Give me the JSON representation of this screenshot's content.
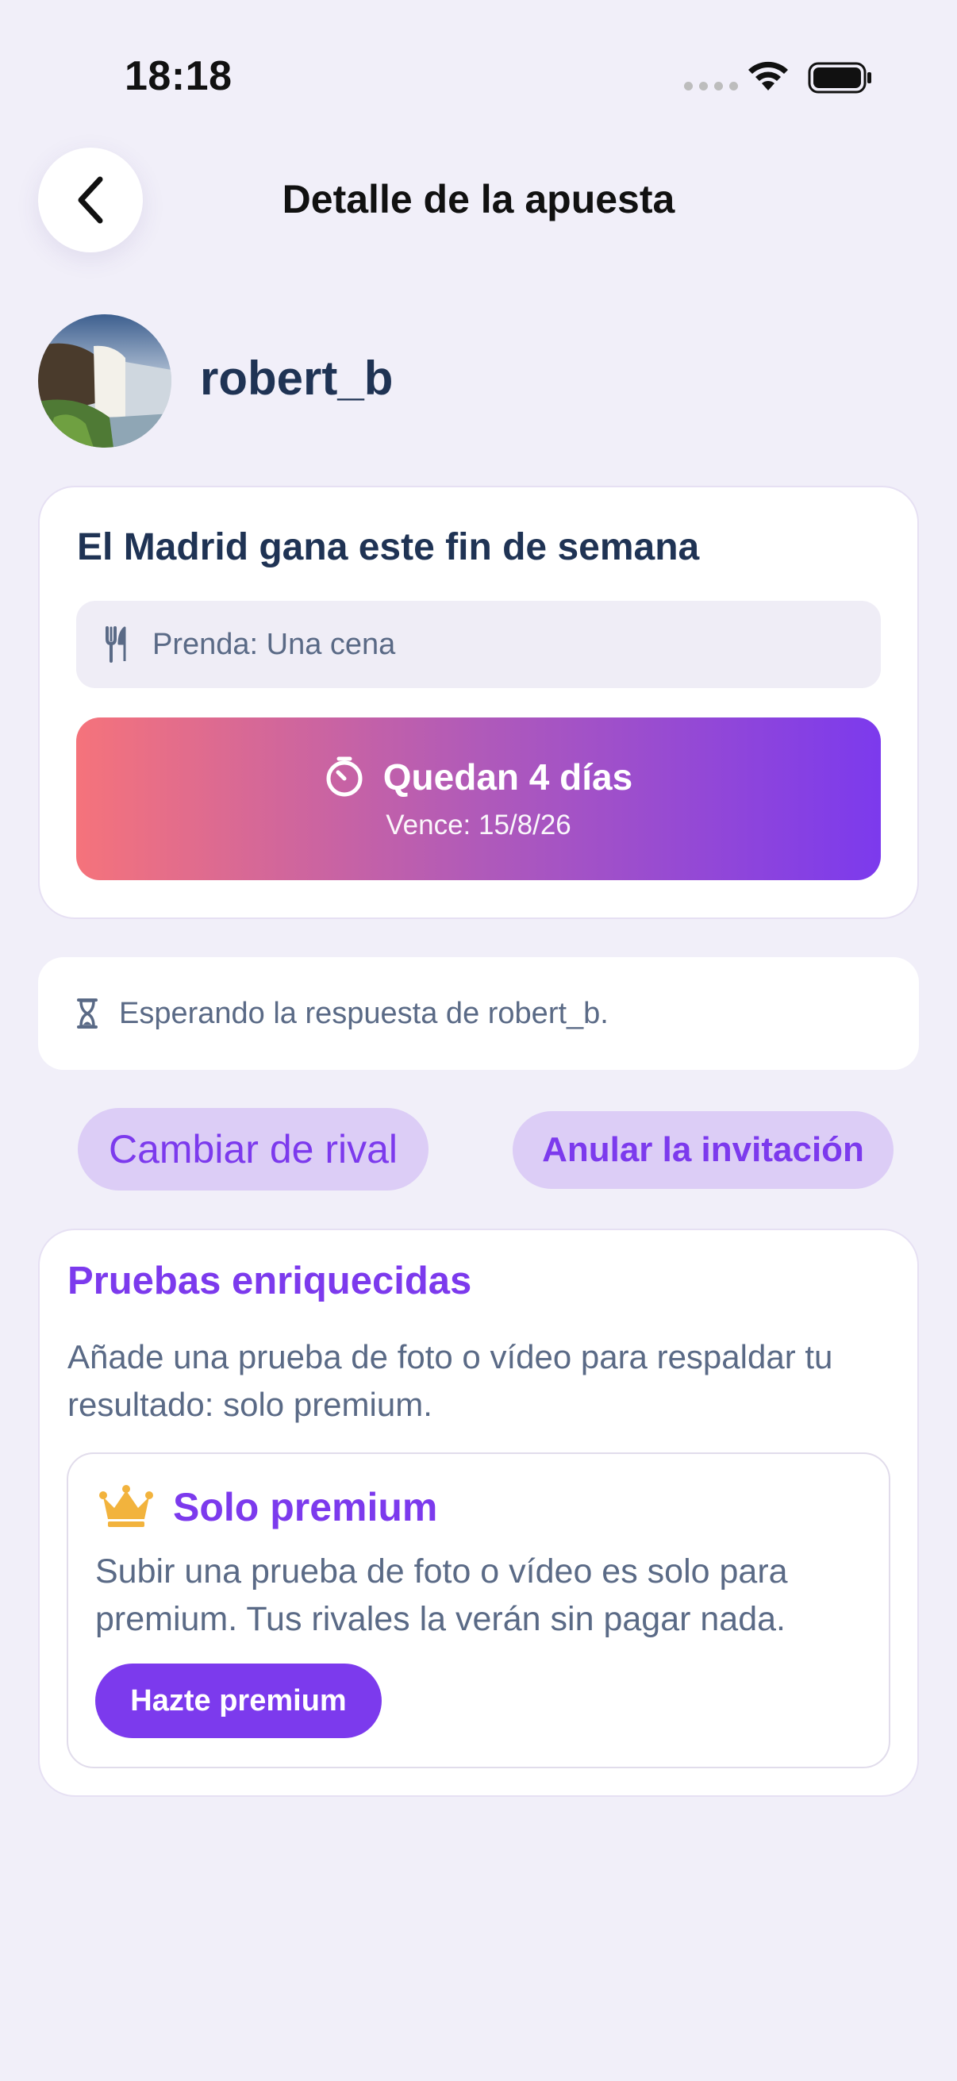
{
  "status_bar": {
    "time": "18:18",
    "icons": [
      "cellular-icon",
      "wifi-icon",
      "battery-icon"
    ]
  },
  "header": {
    "title": "Detalle de la apuesta",
    "back_icon": "chevron-left-icon"
  },
  "user": {
    "username": "robert_b",
    "avatar": "waterfall-landscape-photo"
  },
  "bet": {
    "title": "El Madrid gana este fin de semana",
    "stake": "Prenda: Una cena",
    "stake_icon": "fork-knife-icon",
    "countdown": {
      "label": "Quedan 4 días",
      "due": "Vence: 15/8/26",
      "icon": "timer-icon",
      "gradient": [
        "#f5737b",
        "#7c3aed"
      ]
    }
  },
  "waiting": {
    "text": "Esperando la respuesta de robert_b.",
    "icon": "hourglass-icon"
  },
  "actions": {
    "change_rival": "Cambiar de rival",
    "cancel_invitation": "Anular la invitación"
  },
  "evidence": {
    "title": "Pruebas enriquecidas",
    "description": "Añade una prueba de foto o vídeo para respaldar tu resultado: solo premium.",
    "premium": {
      "icon": "crown-icon",
      "title": "Solo premium",
      "description": "Subir una prueba de foto o vídeo es solo para premium. Tus rivales la verán sin pagar nada.",
      "button": "Hazte premium"
    }
  },
  "colors": {
    "accent": "#7c3aed",
    "accent_soft": "#dccdf6",
    "background": "#f1eff9",
    "text_primary": "#1f3354",
    "text_secondary": "#5a6a86",
    "crown": "#f2b33d"
  }
}
